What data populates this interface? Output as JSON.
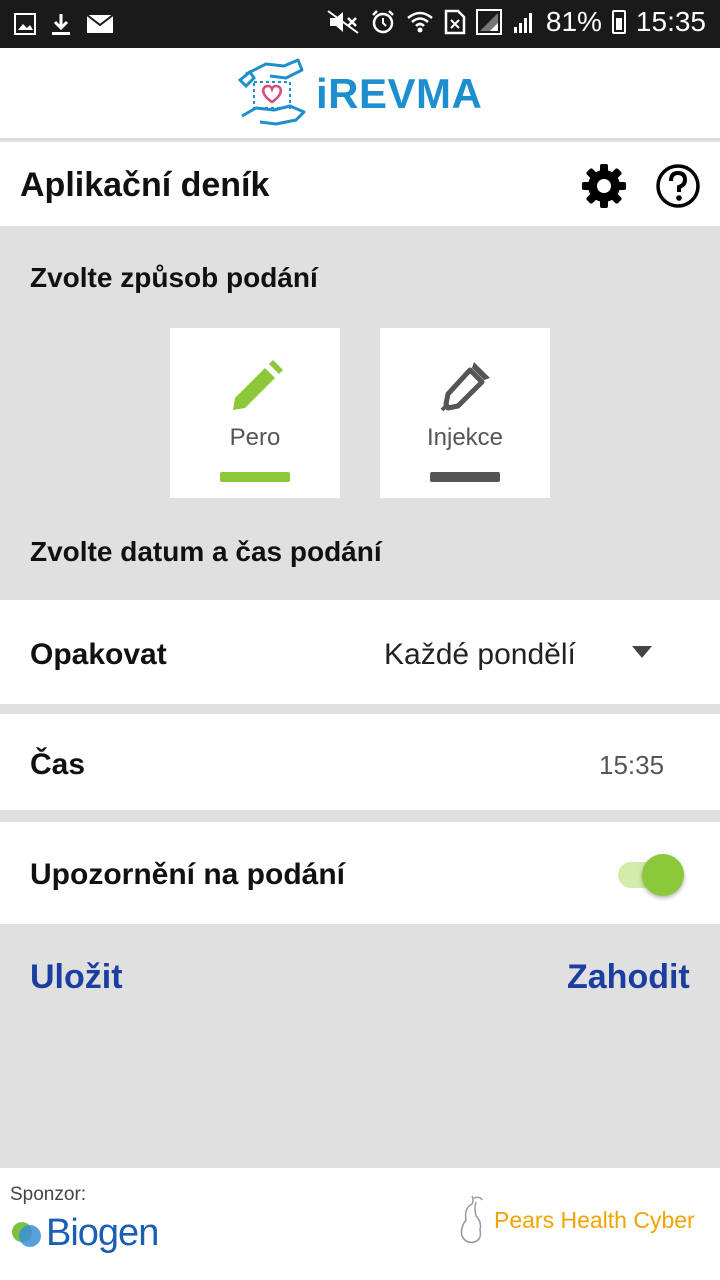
{
  "status_bar": {
    "battery": "81%",
    "time": "15:35"
  },
  "app": {
    "name": "iREVMA"
  },
  "header": {
    "title": "Aplikační deník"
  },
  "colors": {
    "brand": "#1d8fcf",
    "accent_green": "#8bc83a",
    "action_blue": "#1b3fa0"
  },
  "method": {
    "heading": "Zvolte způsob podání",
    "options": [
      {
        "label": "Pero",
        "icon": "pen-icon",
        "selected": true
      },
      {
        "label": "Injekce",
        "icon": "syringe-icon",
        "selected": false
      }
    ]
  },
  "datetime": {
    "heading": "Zvolte datum a čas podání"
  },
  "repeat": {
    "label": "Opakovat",
    "value": "Každé pondělí"
  },
  "time": {
    "label": "Čas",
    "value": "15:35"
  },
  "reminder": {
    "label": "Upozornění na podání",
    "enabled": true
  },
  "actions": {
    "save": "Uložit",
    "discard": "Zahodit"
  },
  "footer": {
    "sponsor_label": "Sponzor:",
    "sponsor_name": "Biogen",
    "partner_name": "Pears Health Cyber"
  }
}
